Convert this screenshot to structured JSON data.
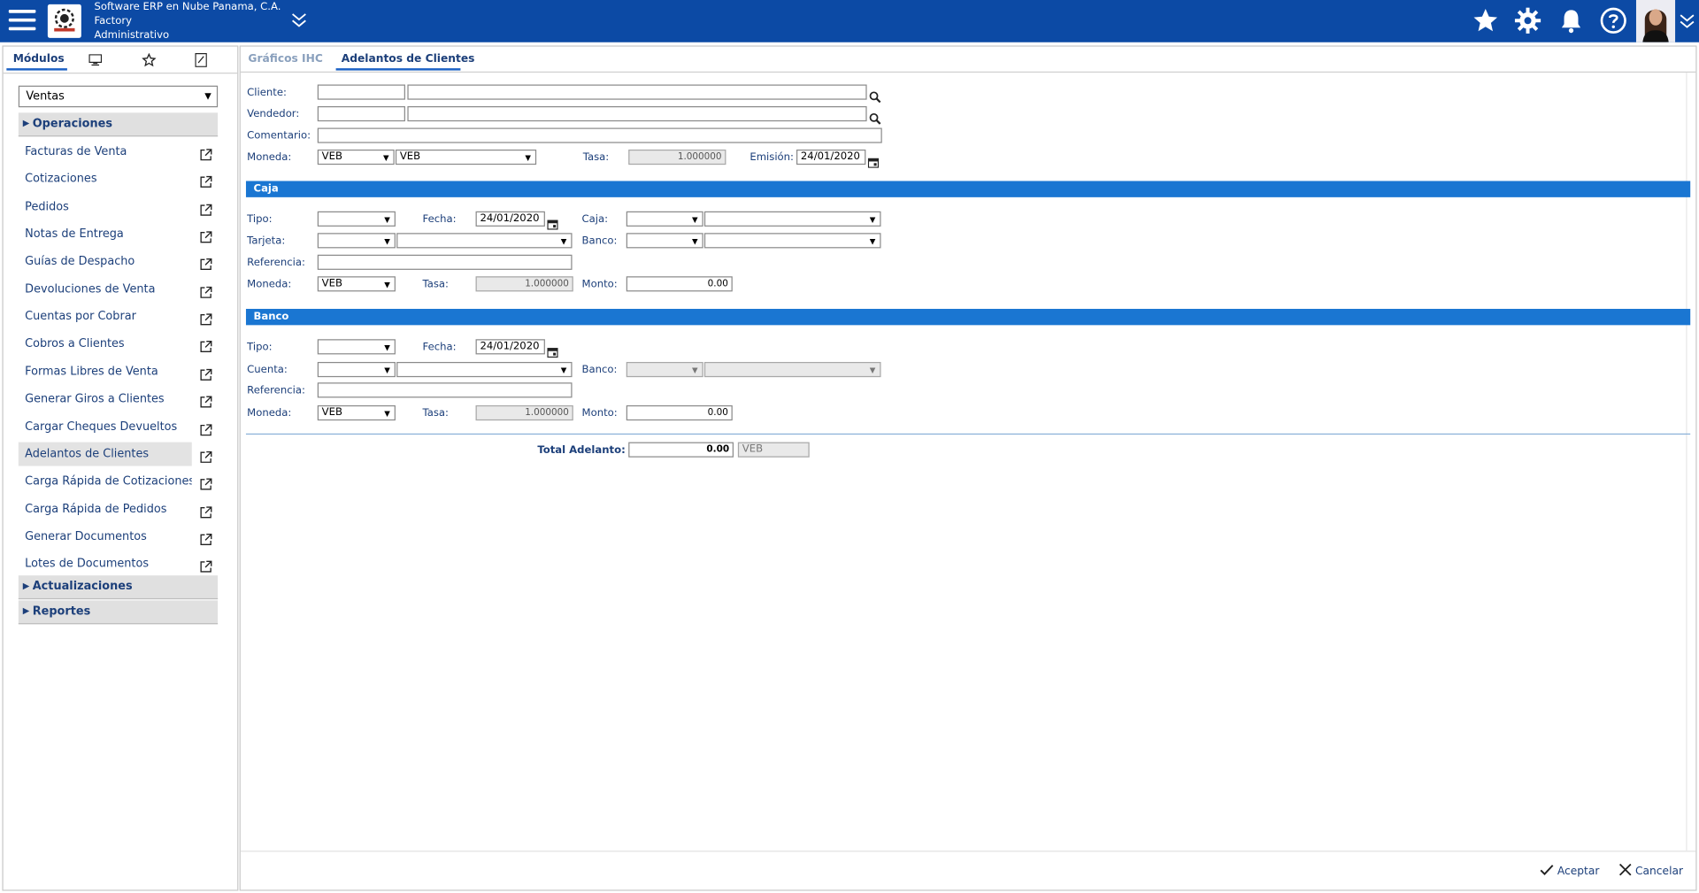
{
  "header": {
    "company": "Software ERP en Nube Panama, C.A.",
    "branch": "Factory",
    "role": "Administrativo"
  },
  "left_panel": {
    "tab_modulos": "Módulos",
    "module_select": "Ventas",
    "sections": {
      "operaciones": "Operaciones",
      "actualizaciones": "Actualizaciones",
      "reportes": "Reportes"
    },
    "items": [
      "Facturas de Venta",
      "Cotizaciones",
      "Pedidos",
      "Notas de Entrega",
      "Guías de Despacho",
      "Devoluciones de Venta",
      "Cuentas por Cobrar",
      "Cobros a Clientes",
      "Formas Libres de Venta",
      "Generar Giros a Clientes",
      "Cargar Cheques Devueltos",
      "Adelantos de Clientes",
      "Carga Rápida de Cotizaciones",
      "Carga Rápida de Pedidos",
      "Generar Documentos",
      "Lotes de Documentos"
    ]
  },
  "tabs": {
    "graficos": "Gráficos IHC",
    "adelantos": "Adelantos de Clientes"
  },
  "form": {
    "cliente_label": "Cliente:",
    "vendedor_label": "Vendedor:",
    "comentario_label": "Comentario:",
    "moneda_label": "Moneda:",
    "moneda_code": "VEB",
    "moneda_name": "VEB",
    "tasa_label": "Tasa:",
    "tasa_value": "1.000000",
    "emision_label": "Emisión:",
    "emision_value": "24/01/2020"
  },
  "caja": {
    "title": "Caja",
    "tipo_label": "Tipo:",
    "fecha_label": "Fecha:",
    "fecha_value": "24/01/2020",
    "caja_label": "Caja:",
    "tarjeta_label": "Tarjeta:",
    "banco_label": "Banco:",
    "referencia_label": "Referencia:",
    "moneda_label": "Moneda:",
    "moneda_value": "VEB",
    "tasa_label": "Tasa:",
    "tasa_value": "1.000000",
    "monto_label": "Monto:",
    "monto_value": "0.00"
  },
  "banco": {
    "title": "Banco",
    "tipo_label": "Tipo:",
    "fecha_label": "Fecha:",
    "fecha_value": "24/01/2020",
    "cuenta_label": "Cuenta:",
    "banco_label": "Banco:",
    "referencia_label": "Referencia:",
    "moneda_label": "Moneda:",
    "moneda_value": "VEB",
    "tasa_label": "Tasa:",
    "tasa_value": "1.000000",
    "monto_label": "Monto:",
    "monto_value": "0.00"
  },
  "total": {
    "label": "Total Adelanto:",
    "value": "0.00",
    "currency": "VEB"
  },
  "footer": {
    "accept": "Aceptar",
    "cancel": "Cancelar"
  },
  "colors": {
    "topbar": "#0c4aa5",
    "section_bar": "#1a76d2",
    "label_text": "#1c3f7a"
  }
}
